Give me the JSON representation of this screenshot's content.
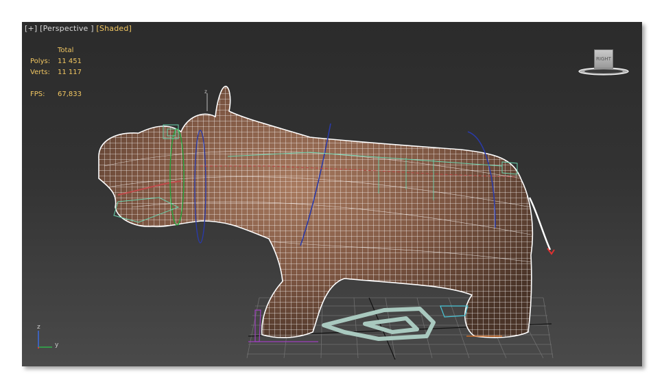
{
  "viewport": {
    "label_plus": "[+]",
    "label_view": "[Perspective ]",
    "label_mode": "[Shaded]"
  },
  "stats": {
    "header": "Total",
    "polys_label": "Polys:",
    "polys_value": "11 451",
    "verts_label": "Verts:",
    "verts_value": "11 117",
    "fps_label": "FPS:",
    "fps_value": "67,833"
  },
  "viewcube": {
    "face_label": "RIGHT"
  },
  "axes": {
    "z": "z",
    "y": "y"
  },
  "colors": {
    "stats_text": "#f3c862",
    "label_text": "#d8d8d8",
    "wire": "#ffffff",
    "body_shade": "#8a6048"
  }
}
